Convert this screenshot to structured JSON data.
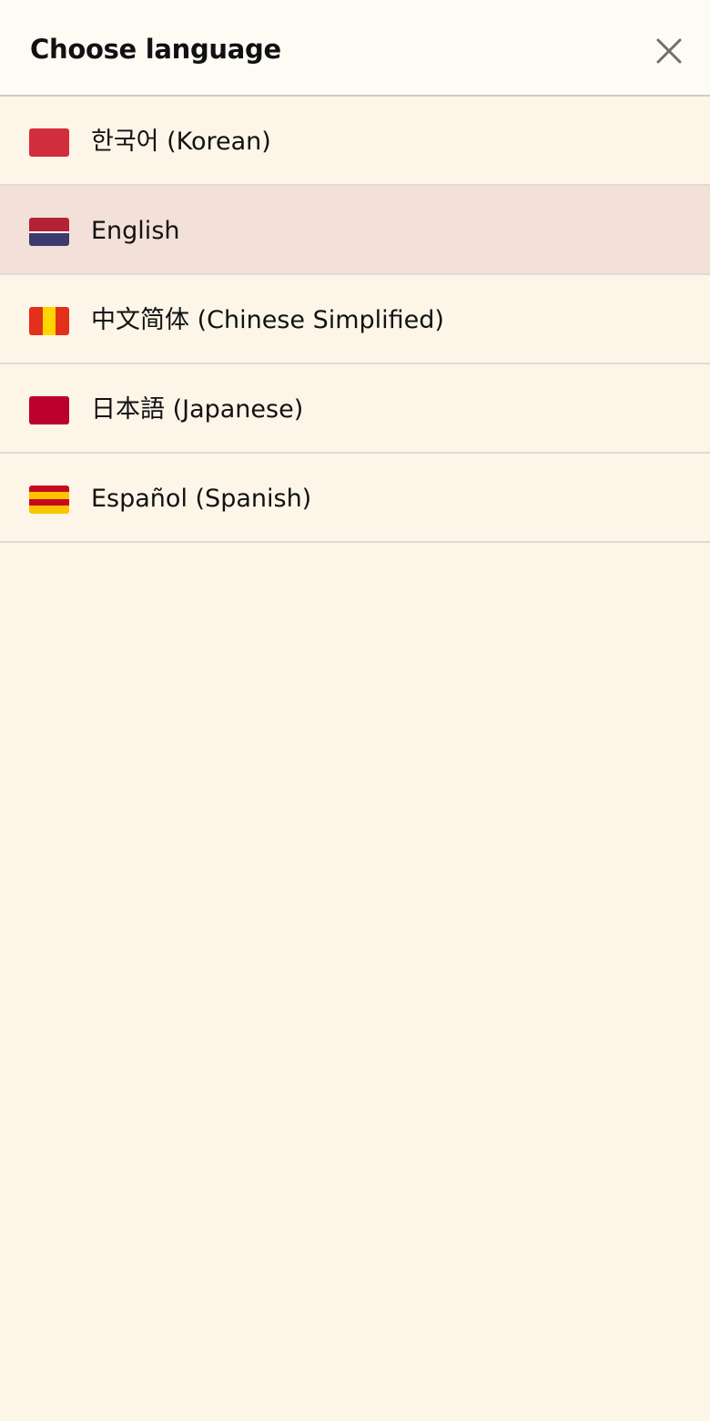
{
  "dialog": {
    "title": "Choose language",
    "close_icon": "close-icon"
  },
  "languages": [
    {
      "label": "한국어 (Korean)",
      "flag_icon": "korea-flag-icon",
      "selected": false,
      "colors": [
        "#d22d3c"
      ]
    },
    {
      "label": "English",
      "flag_icon": "english-flag-icon",
      "selected": true,
      "colors": [
        "#b22234",
        "#3c3b6e"
      ]
    },
    {
      "label": "中文简体 (Chinese Simplified)",
      "flag_icon": "chinese-flag-icon",
      "selected": false,
      "colors": [
        "#e2301b",
        "#ffd500"
      ]
    },
    {
      "label": "日本語 (Japanese)",
      "flag_icon": "japan-flag-icon",
      "selected": false,
      "colors": [
        "#bc002d"
      ]
    },
    {
      "label": "Español (Spanish)",
      "flag_icon": "spain-flag-icon",
      "selected": false,
      "colors": [
        "#c60b1e",
        "#ffc400"
      ]
    }
  ],
  "colors": {
    "background": "#fcf5e8",
    "header_background": "#fefbf5",
    "selected_row": "#f3e0d8",
    "divider": "#dfdbd5",
    "close_icon": "#6e6e6e"
  }
}
